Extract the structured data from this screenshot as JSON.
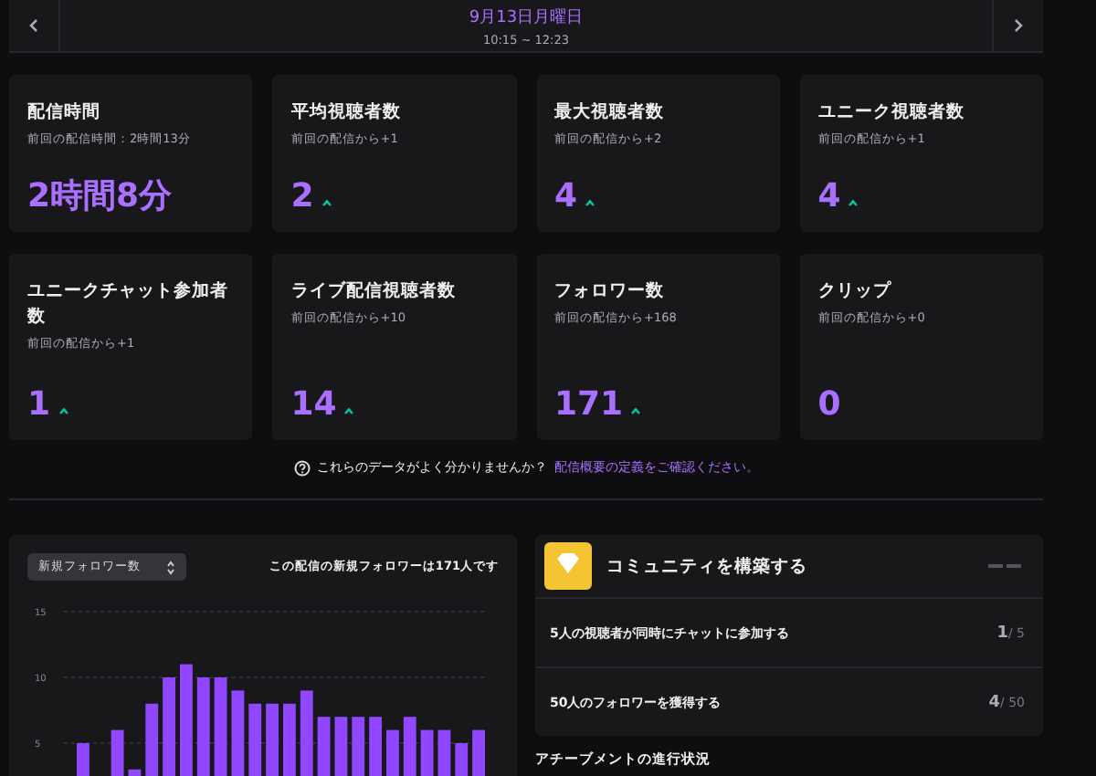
{
  "date_nav": {
    "date": "9月13日月曜日",
    "time_range": "10:15 ~ 12:23"
  },
  "stats": [
    {
      "label": "配信時間",
      "sub": "前回の配信時間：2時間13分",
      "value": "2時間8分",
      "up": false
    },
    {
      "label": "平均視聴者数",
      "sub": "前回の配信から+1",
      "value": "2",
      "up": true
    },
    {
      "label": "最大視聴者数",
      "sub": "前回の配信から+2",
      "value": "4",
      "up": true
    },
    {
      "label": "ユニーク視聴者数",
      "sub": "前回の配信から+1",
      "value": "4",
      "up": true
    },
    {
      "label": "ユニークチャット参加者数",
      "sub": "前回の配信から+1",
      "value": "1",
      "up": true
    },
    {
      "label": "ライブ配信視聴者数",
      "sub": "前回の配信から+10",
      "value": "14",
      "up": true
    },
    {
      "label": "フォロワー数",
      "sub": "前回の配信から+168",
      "value": "171",
      "up": true
    },
    {
      "label": "クリップ",
      "sub": "前回の配信から+0",
      "value": "0",
      "up": false
    }
  ],
  "help": {
    "text": "これらのデータがよく分かりませんか？",
    "link": "配信概要の定義をご確認ください。"
  },
  "chart_panel": {
    "metric_select": "新規フォロワー数",
    "summary": "この配信の新規フォロワーは171人です",
    "chart_data": {
      "type": "bar",
      "series": [
        {
          "color": "#9147ff",
          "values": [
            5,
            null,
            6,
            3,
            8,
            10,
            11,
            10,
            10,
            9,
            8,
            8,
            8,
            9,
            7,
            7,
            7,
            7,
            6,
            7,
            6,
            6,
            5,
            6
          ]
        }
      ],
      "ylim": [
        2.5,
        15
      ],
      "yticks": [
        5,
        10,
        15
      ]
    }
  },
  "community": {
    "title": "コミュニティを構築する",
    "tasks": [
      {
        "text": "5人の視聴者が同時にチャットに参加する",
        "done_count": "1",
        "goal": "/ 5"
      },
      {
        "text": "50人のフォロワーを獲得する",
        "done_count": "4",
        "goal": "/ 50"
      }
    ]
  },
  "achievements_heading": "アチーブメントの進行状況"
}
